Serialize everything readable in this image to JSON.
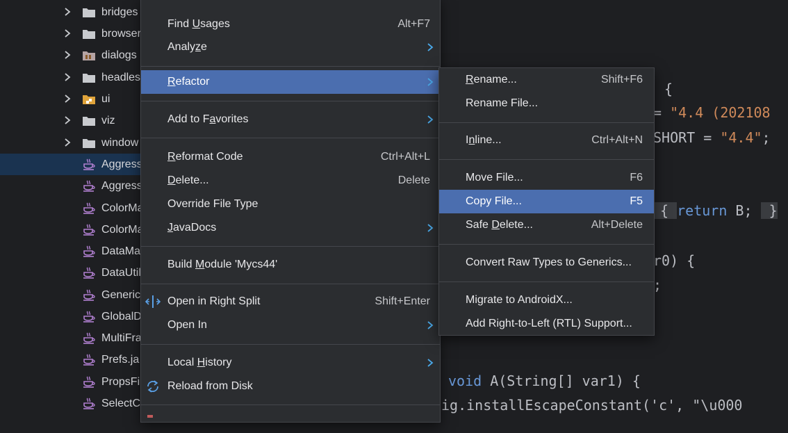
{
  "tree": {
    "items": [
      {
        "label": "bridges",
        "type": "folder",
        "expandable": true
      },
      {
        "label": "browser",
        "type": "folder",
        "expandable": true
      },
      {
        "label": "dialogs",
        "type": "folder-special",
        "expandable": true
      },
      {
        "label": "headles",
        "type": "folder",
        "expandable": true
      },
      {
        "label": "ui",
        "type": "package",
        "expandable": true
      },
      {
        "label": "viz",
        "type": "folder",
        "expandable": true
      },
      {
        "label": "window",
        "type": "folder",
        "expandable": true
      },
      {
        "label": "Aggress",
        "type": "java",
        "selected": true
      },
      {
        "label": "Aggress",
        "type": "java"
      },
      {
        "label": "ColorMa",
        "type": "java"
      },
      {
        "label": "ColorMa",
        "type": "java"
      },
      {
        "label": "DataMa",
        "type": "java"
      },
      {
        "label": "DataUtil",
        "type": "java"
      },
      {
        "label": "Generic",
        "type": "java"
      },
      {
        "label": "GlobalD",
        "type": "java"
      },
      {
        "label": "MultiFra",
        "type": "java"
      },
      {
        "label": "Prefs.ja",
        "type": "java"
      },
      {
        "label": "PropsFi",
        "type": "java"
      },
      {
        "label": "SelectC",
        "type": "java"
      }
    ]
  },
  "editor": {
    "lines": [
      {
        "segments": [
          {
            "t": "{",
            "c": "plain"
          }
        ]
      },
      {
        "segments": [
          {
            "t": "= ",
            "c": "plain"
          },
          {
            "t": "\"4.4 (202108",
            "c": "str"
          }
        ]
      },
      {
        "segments": [
          {
            "t": "SHORT = ",
            "c": "plain"
          },
          {
            "t": "\"4.4\"",
            "c": "str"
          },
          {
            "t": ";",
            "c": "plain"
          }
        ]
      },
      {
        "segments": [
          {
            "t": " { ",
            "c": "fold"
          },
          {
            "t": "return",
            "c": "kw"
          },
          {
            "t": " B; ",
            "c": "plain"
          },
          {
            "t": " }",
            "c": "fold"
          }
        ]
      },
      {
        "segments": [
          {
            "t": "r0) {",
            "c": "plain"
          }
        ]
      },
      {
        "segments": [
          {
            "t": ";",
            "c": "plain"
          }
        ]
      },
      {
        "segments": [
          {
            "t": "void",
            "c": "kw"
          },
          {
            "t": " A(String[] var1) {",
            "c": "plain"
          }
        ]
      },
      {
        "segments": [
          {
            "t": "ig.installEscapeConstant('c', \"\\u000",
            "c": "plain"
          }
        ]
      }
    ]
  },
  "context_menu": {
    "items": [
      {
        "kind": "item",
        "id": "find-usages",
        "pre": "Find ",
        "mn": "U",
        "post": "sages",
        "shortcut": "Alt+F7"
      },
      {
        "kind": "item",
        "id": "analyze",
        "pre": "Analy",
        "mn": "z",
        "post": "e",
        "submenu": true
      },
      {
        "kind": "sep"
      },
      {
        "kind": "item",
        "id": "refactor",
        "pre": "",
        "mn": "R",
        "post": "efactor",
        "submenu": true,
        "highlighted": true
      },
      {
        "kind": "sep"
      },
      {
        "kind": "item",
        "id": "add-to-favorites",
        "pre": "Add to F",
        "mn": "a",
        "post": "vorites",
        "submenu": true
      },
      {
        "kind": "sep"
      },
      {
        "kind": "item",
        "id": "reformat-code",
        "pre": "",
        "mn": "R",
        "post": "eformat Code",
        "shortcut": "Ctrl+Alt+L"
      },
      {
        "kind": "item",
        "id": "delete",
        "pre": "",
        "mn": "D",
        "post": "elete...",
        "shortcut": "Delete"
      },
      {
        "kind": "item",
        "id": "override-file-type",
        "pre": "Override File Type",
        "mn": "",
        "post": ""
      },
      {
        "kind": "item",
        "id": "javadocs",
        "pre": "",
        "mn": "J",
        "post": "avaDocs",
        "submenu": true
      },
      {
        "kind": "sep"
      },
      {
        "kind": "item",
        "id": "build-module",
        "pre": "Build ",
        "mn": "M",
        "post": "odule 'Mycs44'"
      },
      {
        "kind": "sep"
      },
      {
        "kind": "item",
        "id": "open-in-right-split",
        "pre": "Open in Right Split",
        "mn": "",
        "post": "",
        "shortcut": "Shift+Enter",
        "icon": "split-icon"
      },
      {
        "kind": "item",
        "id": "open-in",
        "pre": "Open In",
        "mn": "",
        "post": "",
        "submenu": true
      },
      {
        "kind": "sep"
      },
      {
        "kind": "item",
        "id": "local-history",
        "pre": "Local ",
        "mn": "H",
        "post": "istory",
        "submenu": true
      },
      {
        "kind": "item",
        "id": "reload-from-disk",
        "pre": "Reload from Disk",
        "mn": "",
        "post": "",
        "icon": "reload-icon"
      },
      {
        "kind": "sep"
      },
      {
        "kind": "item",
        "id": "partial-item",
        "pre": "",
        "mn": "",
        "post": "",
        "icon": "partial-icon"
      }
    ]
  },
  "refactor_submenu": {
    "items": [
      {
        "kind": "item",
        "id": "rename",
        "pre": "",
        "mn": "R",
        "post": "ename...",
        "shortcut": "Shift+F6"
      },
      {
        "kind": "item",
        "id": "rename-file",
        "pre": "Rename File...",
        "mn": "",
        "post": ""
      },
      {
        "kind": "sep"
      },
      {
        "kind": "item",
        "id": "inline",
        "pre": "I",
        "mn": "n",
        "post": "line...",
        "shortcut": "Ctrl+Alt+N"
      },
      {
        "kind": "sep"
      },
      {
        "kind": "item",
        "id": "move-file",
        "pre": "Move File...",
        "mn": "",
        "post": "",
        "shortcut": "F6"
      },
      {
        "kind": "item",
        "id": "copy-file",
        "pre": "Copy File...",
        "mn": "",
        "post": "",
        "shortcut": "F5",
        "highlighted": true
      },
      {
        "kind": "item",
        "id": "safe-delete",
        "pre": "Safe ",
        "mn": "D",
        "post": "elete...",
        "shortcut": "Alt+Delete"
      },
      {
        "kind": "sep"
      },
      {
        "kind": "item",
        "id": "convert-raw-types",
        "pre": "Convert Raw Types to Generics...",
        "mn": "",
        "post": ""
      },
      {
        "kind": "sep"
      },
      {
        "kind": "item",
        "id": "migrate-androidx",
        "pre": "Migrate to AndroidX...",
        "mn": "",
        "post": ""
      },
      {
        "kind": "item",
        "id": "add-rtl-support",
        "pre": "Add Right-to-Left (RTL) Support...",
        "mn": "",
        "post": ""
      }
    ]
  },
  "colors": {
    "background": "#1e1f22",
    "menu_bg": "#2b2d30",
    "highlight": "#4b6eaf",
    "keyword": "#6897d6",
    "string": "#d08a5a",
    "java_icon": "#b07fd0",
    "folder_icon": "#c8cace",
    "package_icon": "#e0a43b"
  }
}
